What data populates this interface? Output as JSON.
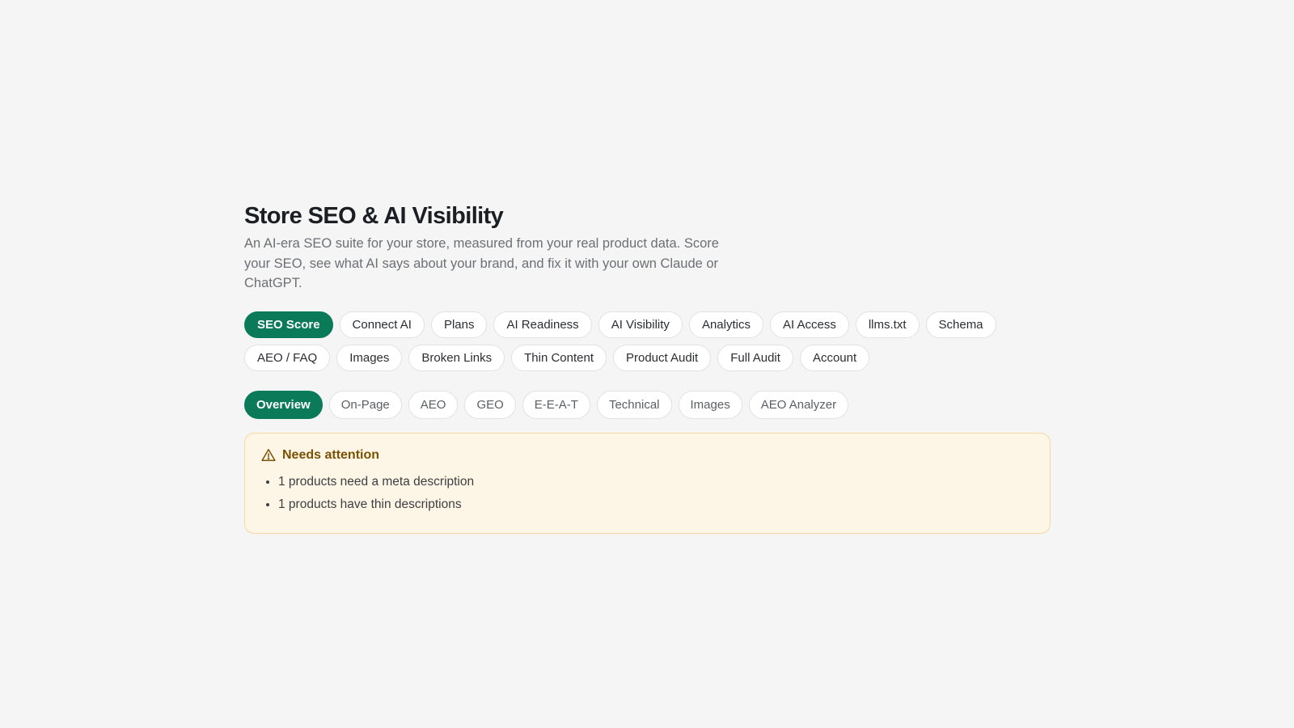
{
  "header": {
    "title": "Store SEO & AI Visibility",
    "subtitle": "An AI-era SEO suite for your store, measured from your real product data. Score your SEO, see what AI says about your brand, and fix it with your own Claude or ChatGPT."
  },
  "main_tabs": [
    {
      "label": "SEO Score",
      "active": true
    },
    {
      "label": "Connect AI"
    },
    {
      "label": "Plans"
    },
    {
      "label": "AI Readiness"
    },
    {
      "label": "AI Visibility"
    },
    {
      "label": "Analytics"
    },
    {
      "label": "AI Access"
    },
    {
      "label": "llms.txt"
    },
    {
      "label": "Schema"
    },
    {
      "label": "AEO / FAQ"
    },
    {
      "label": "Images"
    },
    {
      "label": "Broken Links"
    },
    {
      "label": "Thin Content"
    },
    {
      "label": "Product Audit"
    },
    {
      "label": "Full Audit"
    },
    {
      "label": "Account"
    }
  ],
  "sub_tabs": [
    {
      "label": "Overview",
      "active": true
    },
    {
      "label": "On-Page"
    },
    {
      "label": "AEO"
    },
    {
      "label": "GEO"
    },
    {
      "label": "E-E-A-T"
    },
    {
      "label": "Technical"
    },
    {
      "label": "Images"
    },
    {
      "label": "AEO Analyzer"
    }
  ],
  "alert": {
    "icon": "warning-triangle-icon",
    "title": "Needs attention",
    "items": [
      "1 products need a meta description",
      "1 products have thin descriptions"
    ]
  },
  "colors": {
    "accent": "#0b7a58",
    "alert_bg": "#fdf5e6",
    "alert_border": "#f3d9a4",
    "alert_title": "#7a5105"
  }
}
